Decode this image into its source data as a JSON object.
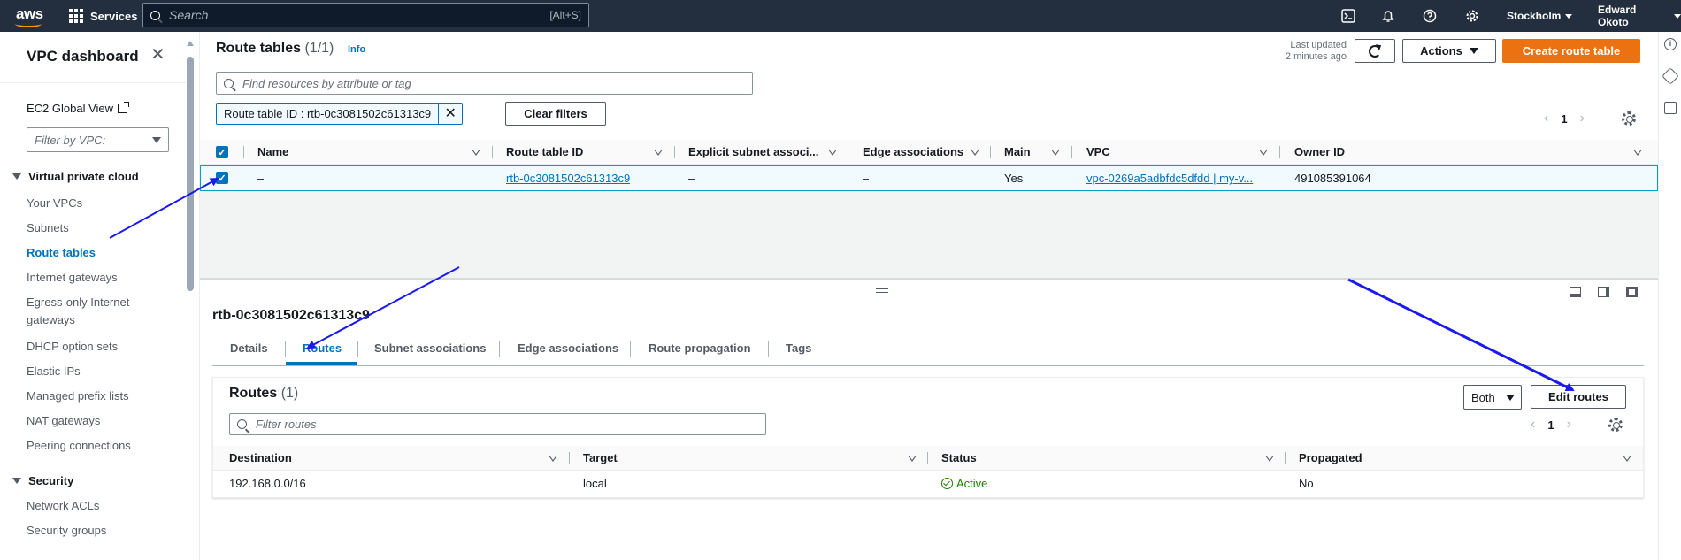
{
  "topnav": {
    "logo": "aws",
    "services": "Services",
    "search_placeholder": "Search",
    "search_shortcut": "[Alt+S]",
    "region": "Stockholm",
    "user": "Edward Okoto",
    "icons": [
      "cloudshell-icon",
      "bell-icon",
      "help-icon",
      "gear-icon"
    ]
  },
  "sidebar": {
    "title": "VPC dashboard",
    "ec2_link": "EC2 Global View",
    "filter_placeholder": "Filter by VPC:",
    "section_vpc": "Virtual private cloud",
    "items": [
      "Your VPCs",
      "Subnets",
      "Route tables",
      "Internet gateways",
      "Egress-only Internet gateways",
      "DHCP option sets",
      "Elastic IPs",
      "Managed prefix lists",
      "NAT gateways",
      "Peering connections"
    ],
    "active_item": "Route tables",
    "section_security": "Security",
    "security_items": [
      "Network ACLs",
      "Security groups"
    ]
  },
  "header": {
    "title": "Route tables",
    "count": "(1/1)",
    "info": "Info",
    "last_updated_1": "Last updated",
    "last_updated_2": "2 minutes ago",
    "actions": "Actions",
    "create": "Create route table",
    "search_placeholder": "Find resources by attribute or tag",
    "filter_token": "Route table ID : rtb-0c3081502c61313c9",
    "clear_filters": "Clear filters",
    "page": "1"
  },
  "table": {
    "columns": [
      "Name",
      "Route table ID",
      "Explicit subnet associ...",
      "Edge associations",
      "Main",
      "VPC",
      "Owner ID"
    ],
    "row": {
      "name": "–",
      "route_table_id": "rtb-0c3081502c61313c9",
      "explicit_subnet": "–",
      "edge": "–",
      "main": "Yes",
      "vpc": "vpc-0269a5adbfdc5dfdd | my-v...",
      "owner": "491085391064"
    }
  },
  "detail": {
    "title": "rtb-0c3081502c61313c9",
    "tabs": [
      "Details",
      "Routes",
      "Subnet associations",
      "Edge associations",
      "Route propagation",
      "Tags"
    ],
    "active_tab": "Routes",
    "routes_title": "Routes",
    "routes_count": "(1)",
    "both": "Both",
    "edit_routes": "Edit routes",
    "filter_placeholder": "Filter routes",
    "page": "1",
    "columns": [
      "Destination",
      "Target",
      "Status",
      "Propagated"
    ],
    "row": {
      "destination": "192.168.0.0/16",
      "target": "local",
      "status": "Active",
      "propagated": "No"
    }
  },
  "colors": {
    "nav_bg": "#232f3e",
    "link": "#0073bb",
    "primary_button": "#ec7211",
    "success": "#1d8102",
    "annotation_arrow": "#1a1aee"
  }
}
